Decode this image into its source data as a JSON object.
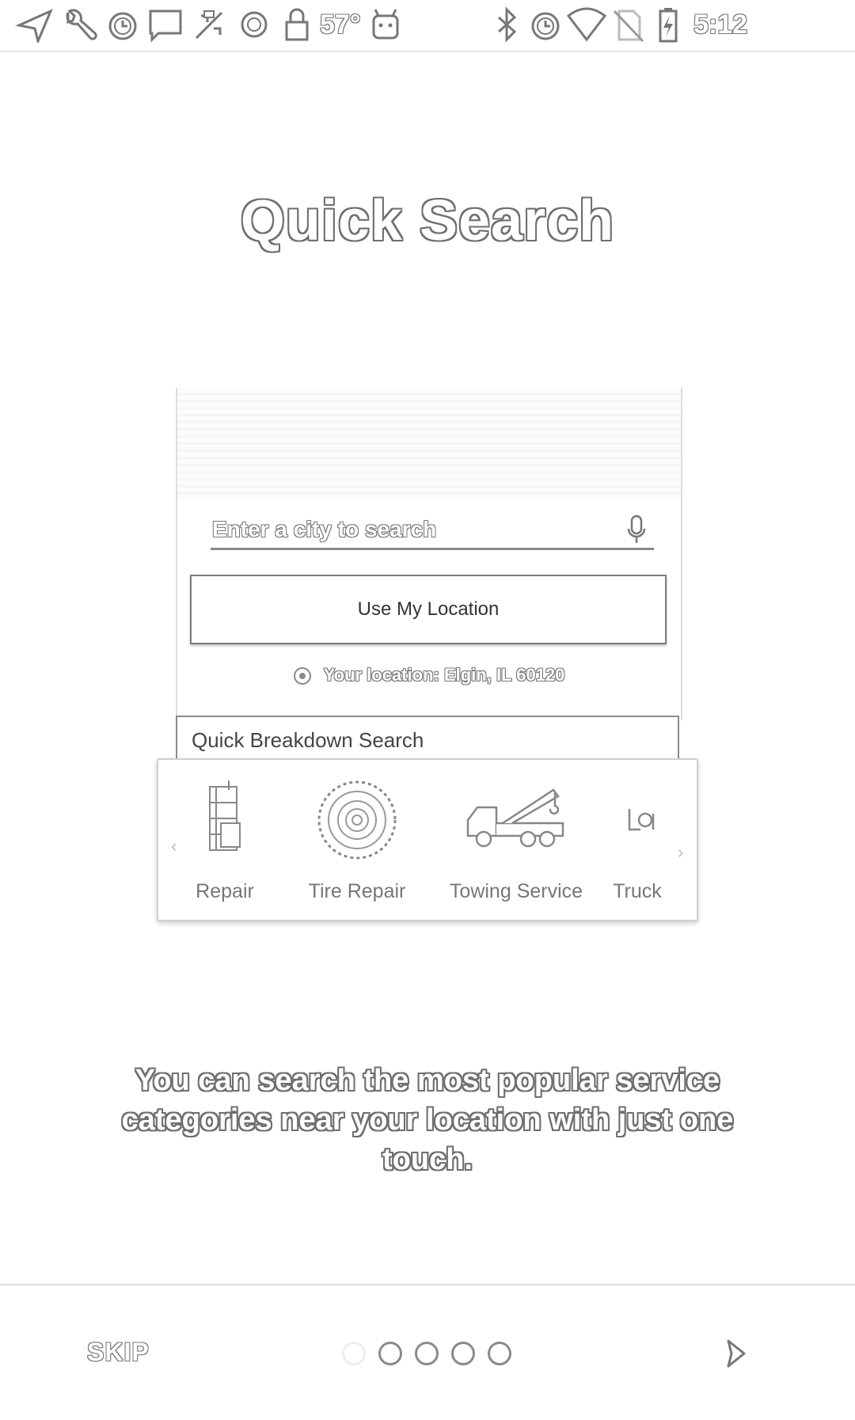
{
  "status_bar": {
    "temperature": "57°",
    "time": "5:12",
    "icons_left": [
      "navigation-icon",
      "wrench-icon",
      "alarm-icon",
      "chat-icon",
      "weather-icon",
      "circle-icon",
      "lock-icon",
      "temperature",
      "android-icon"
    ],
    "icons_right": [
      "bluetooth-icon",
      "alarm-icon",
      "wifi-icon",
      "no-sim-icon",
      "battery-charging-icon",
      "time"
    ]
  },
  "title": "Quick Search",
  "preview": {
    "search_placeholder": "Enter a city to search",
    "use_location_label": "Use My Location",
    "your_location": "Your location: Elgin, IL 60120",
    "quick_breakdown_label": "Quick Breakdown Search",
    "categories": [
      {
        "label": "Repair",
        "icon": "repair-icon"
      },
      {
        "label": "Tire Repair",
        "icon": "tire-icon"
      },
      {
        "label": "Towing Service",
        "icon": "tow-truck-icon"
      },
      {
        "label": "Truck",
        "icon": "truck-icon"
      }
    ]
  },
  "description": "You can search the most popular service categories near your location with just one touch.",
  "footer": {
    "skip_label": "SKIP",
    "page_count": 5,
    "current_page": 1
  }
}
